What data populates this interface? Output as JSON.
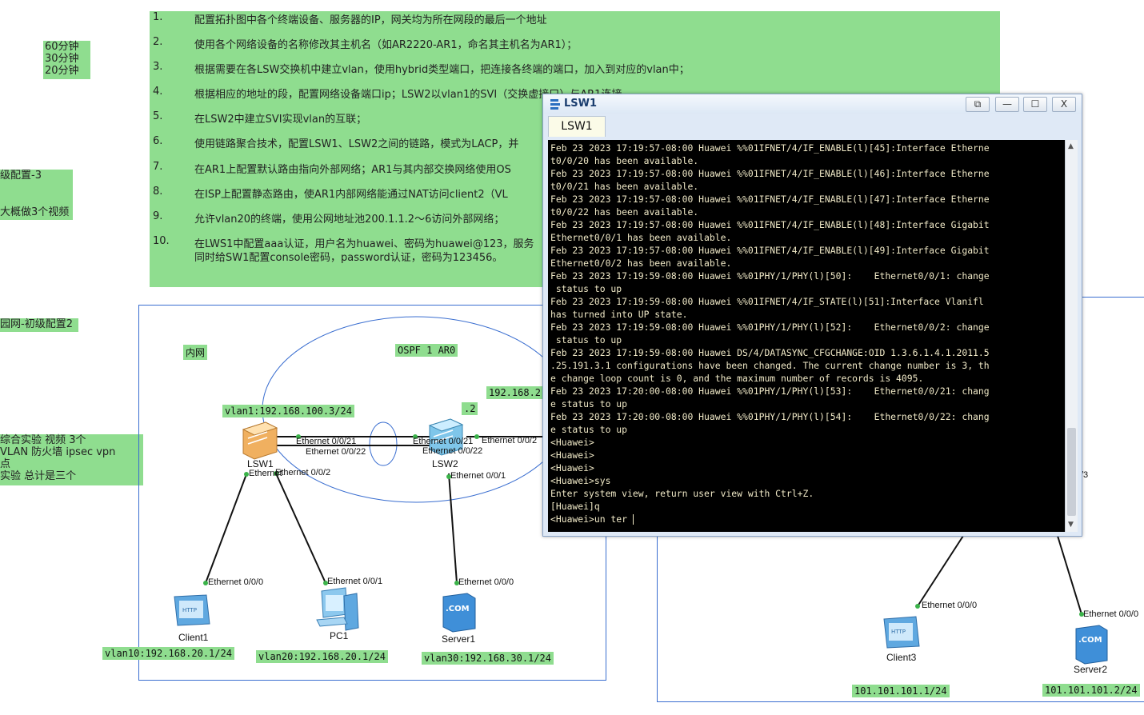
{
  "tasks": [
    {
      "num": "1.",
      "text": "配置拓扑图中各个终端设备、服务器的IP，网关均为所在网段的最后一个地址"
    },
    {
      "num": "2.",
      "text": "使用各个网络设备的名称修改其主机名（如AR2220-AR1，命名其主机名为AR1）；"
    },
    {
      "num": "3.",
      "text": "根据需要在各LSW交换机中建立vlan，使用hybrid类型端口，把连接各终端的端口，加入到对应的vlan中；"
    },
    {
      "num": "4.",
      "text": "根据相应的地址的段，配置网络设备端口ip；LSW2以vlan1的SVI（交换虚接口）与AR1连接。"
    },
    {
      "num": "5.",
      "text": "在LSW2中建立SVI实现vlan的互联；"
    },
    {
      "num": "6.",
      "text": "使用链路聚合技术，配置LSW1、LSW2之间的链路，模式为LACP，并"
    },
    {
      "num": "7.",
      "text": "在AR1上配置默认路由指向外部网络；AR1与其内部交换网络使用OS"
    },
    {
      "num": "8.",
      "text": "在ISP上配置静态路由，使AR1内部网络能通过NAT访问client2（VL"
    },
    {
      "num": "9.",
      "text": "允许vlan20的终端，使用公网地址池200.1.1.2～6访问外部网络；"
    },
    {
      "num": "10.",
      "text": "在LWS1中配置aaa认证，用户名为huawei、密码为huawei@123，服务"
    },
    {
      "num": "",
      "text": "同时给SW1配置console密码，password认证，密码为123456。"
    }
  ],
  "time_note": [
    "60分钟",
    "30分钟",
    "20分钟"
  ],
  "side_notes": {
    "note1a": "级配置-3",
    "note1b": "大概做3个视频",
    "note2": "园网-初级配置2",
    "note3a": "综合实验 视频 3个",
    "note3b": "VLAN 防火墙 ipsec vpn",
    "note3c": "点",
    "note3d": "实验 总计是三个"
  },
  "topology": {
    "area_label": "内网",
    "ospf_label": "OSPF 1 AR0",
    "ip_partial": "192.168.2",
    "dot2": ".2",
    "vlan1_label": "vlan1:192.168.100.3/24",
    "vlan10_label": "vlan10:192.168.20.1/24",
    "vlan20_label": "vlan20:192.168.20.1/24",
    "vlan30_label": "vlan30:192.168.30.1/24",
    "pub1_label": "101.101.101.1/24",
    "pub2_label": "101.101.101.2/24",
    "ports": {
      "p1": "Ethernet 0/0/21",
      "p2": "Ethernet 0/0/22",
      "p3": "Ethernet 0/0/21",
      "p4": "Ethernet 0/0/22",
      "p5": "Ethernet 0/0/2",
      "p6": "Ethernet 0/0/1",
      "p7": "Ethernet 0/0/2",
      "p8": "Ethernet",
      "p9": "Ethernet 0/0/0",
      "p10": "Ethernet 0/0/1",
      "p11": "Ethernet 0/0/0",
      "p12": "Ethernet 0/0/0",
      "p13": "Ethernet 0/0/0",
      "p14": "/3"
    },
    "devices": {
      "lsw1": "LSW1",
      "lsw2": "LSW2",
      "client1": "Client1",
      "pc1": "PC1",
      "server1": "Server1",
      "client3": "Client3",
      "server2": "Server2"
    }
  },
  "window": {
    "title": "LSW1",
    "tab": "LSW1",
    "buttons": {
      "restore": "⧉",
      "minimize": "—",
      "maximize": "☐",
      "close": "X"
    },
    "terminal_lines": [
      "Feb 23 2023 17:19:57-08:00 Huawei %%01IFNET/4/IF_ENABLE(l)[45]:Interface Etherne",
      "t0/0/20 has been available.",
      "Feb 23 2023 17:19:57-08:00 Huawei %%01IFNET/4/IF_ENABLE(l)[46]:Interface Etherne",
      "t0/0/21 has been available.",
      "Feb 23 2023 17:19:57-08:00 Huawei %%01IFNET/4/IF_ENABLE(l)[47]:Interface Etherne",
      "t0/0/22 has been available.",
      "Feb 23 2023 17:19:57-08:00 Huawei %%01IFNET/4/IF_ENABLE(l)[48]:Interface Gigabit",
      "Ethernet0/0/1 has been available.",
      "Feb 23 2023 17:19:57-08:00 Huawei %%01IFNET/4/IF_ENABLE(l)[49]:Interface Gigabit",
      "Ethernet0/0/2 has been available.",
      "Feb 23 2023 17:19:59-08:00 Huawei %%01PHY/1/PHY(l)[50]:    Ethernet0/0/1: change",
      " status to up",
      "Feb 23 2023 17:19:59-08:00 Huawei %%01IFNET/4/IF_STATE(l)[51]:Interface Vlanifl",
      "has turned into UP state.",
      "Feb 23 2023 17:19:59-08:00 Huawei %%01PHY/1/PHY(l)[52]:    Ethernet0/0/2: change",
      " status to up",
      "Feb 23 2023 17:19:59-08:00 Huawei DS/4/DATASYNC_CFGCHANGE:OID 1.3.6.1.4.1.2011.5",
      ".25.191.3.1 configurations have been changed. The current change number is 3, th",
      "e change loop count is 0, and the maximum number of records is 4095.",
      "Feb 23 2023 17:20:00-08:00 Huawei %%01PHY/1/PHY(l)[53]:    Ethernet0/0/21: chang",
      "e status to up",
      "Feb 23 2023 17:20:00-08:00 Huawei %%01PHY/1/PHY(l)[54]:    Ethernet0/0/22: chang",
      "e status to up",
      "<Huawei>",
      "<Huawei>",
      "<Huawei>",
      "<Huawei>sys",
      "Enter system view, return user view with Ctrl+Z.",
      "[Huawei]q",
      "<Huawei>un ter "
    ]
  }
}
